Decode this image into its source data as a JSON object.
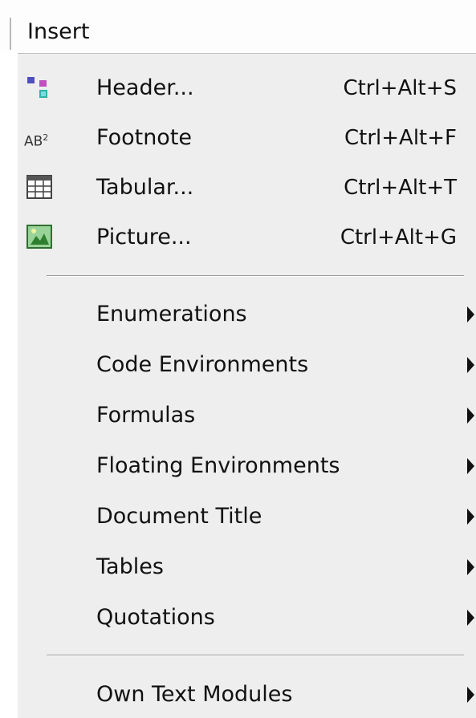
{
  "menu": {
    "title": "Insert"
  },
  "items_top": [
    {
      "label": "Header...",
      "shortcut": "Ctrl+Alt+S",
      "icon": "header-icon"
    },
    {
      "label": "Footnote",
      "shortcut": "Ctrl+Alt+F",
      "icon": "footnote-icon"
    },
    {
      "label": "Tabular...",
      "shortcut": "Ctrl+Alt+T",
      "icon": "tabular-icon"
    },
    {
      "label": "Picture...",
      "shortcut": "Ctrl+Alt+G",
      "icon": "picture-icon"
    }
  ],
  "submenus": [
    {
      "label": "Enumerations"
    },
    {
      "label": "Code Environments"
    },
    {
      "label": "Formulas"
    },
    {
      "label": "Floating Environments"
    },
    {
      "label": "Document Title"
    },
    {
      "label": "Tables"
    },
    {
      "label": "Quotations"
    }
  ],
  "bottom": [
    {
      "label": "Own Text Modules"
    }
  ],
  "footnote_icon_text": {
    "main": "AB",
    "sup": "2"
  }
}
